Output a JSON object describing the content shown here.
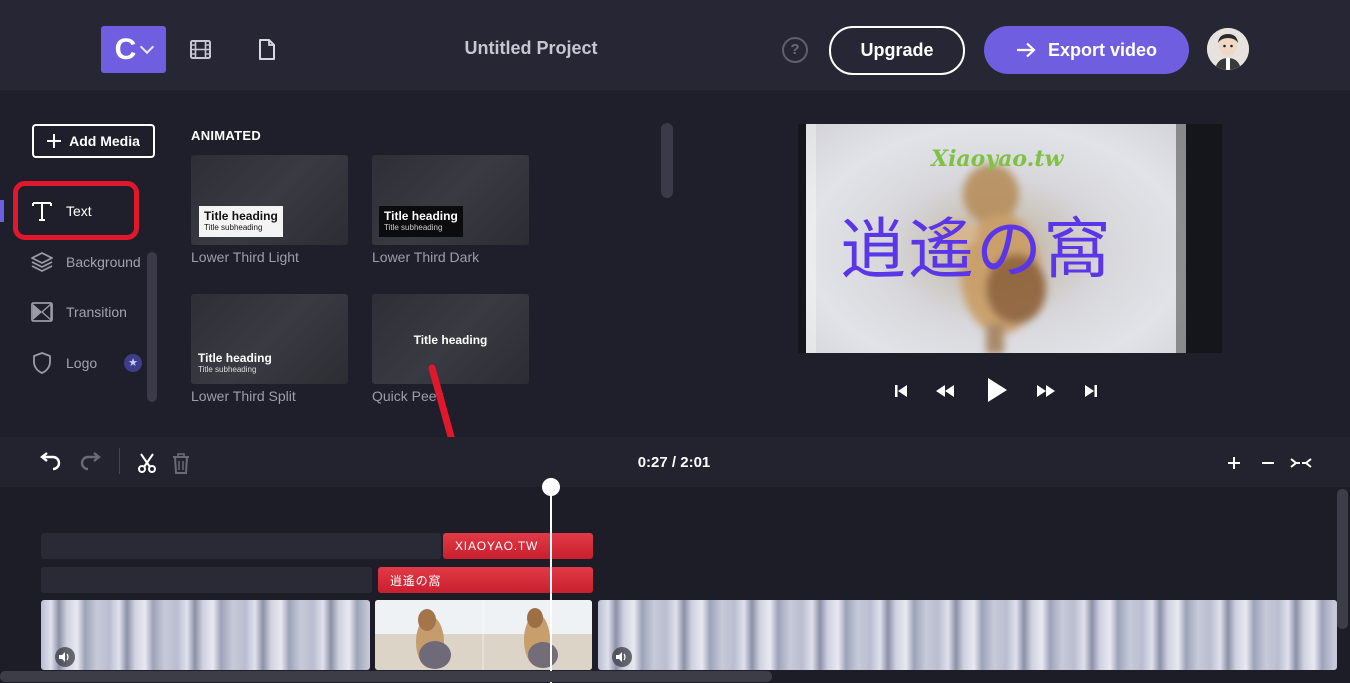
{
  "header": {
    "logo_letter": "C",
    "project_title": "Untitled Project",
    "help_glyph": "?",
    "upgrade_label": "Upgrade",
    "export_label": "Export video"
  },
  "left_nav": {
    "add_media_label": "Add Media",
    "items": [
      {
        "label": "Text",
        "icon": "text-icon",
        "active": true
      },
      {
        "label": "Background",
        "icon": "layers-icon",
        "active": false
      },
      {
        "label": "Transition",
        "icon": "transition-icon",
        "active": false
      },
      {
        "label": "Logo",
        "icon": "shield-icon",
        "active": false,
        "badge": "★"
      }
    ]
  },
  "media_panel": {
    "section_title": "ANIMATED",
    "cards": [
      {
        "label": "Lower Third Light",
        "heading": "Title heading",
        "subheading": "Title subheading"
      },
      {
        "label": "Lower Third Dark",
        "heading": "Title heading",
        "subheading": "Title subheading"
      },
      {
        "label": "Lower Third Split",
        "heading": "Title heading",
        "subheading": "Title subheading"
      },
      {
        "label": "Quick Peek",
        "heading": "Title heading"
      }
    ]
  },
  "preview": {
    "watermark": "Xiaoyao.tw",
    "big_text": "逍遙の窩"
  },
  "timeline": {
    "time": "0:27 / 2:01",
    "clips": {
      "title_clip_1": "XIAOYAO.TW",
      "title_clip_2": "逍遙の窩"
    }
  },
  "colors": {
    "accent": "#6f5fe0",
    "highlight_red": "#e3172b",
    "clip_red": "#d42a39",
    "background": "#1f1f2b",
    "preview_text_purple": "#5a36e8",
    "preview_text_green": "#7fc243"
  }
}
